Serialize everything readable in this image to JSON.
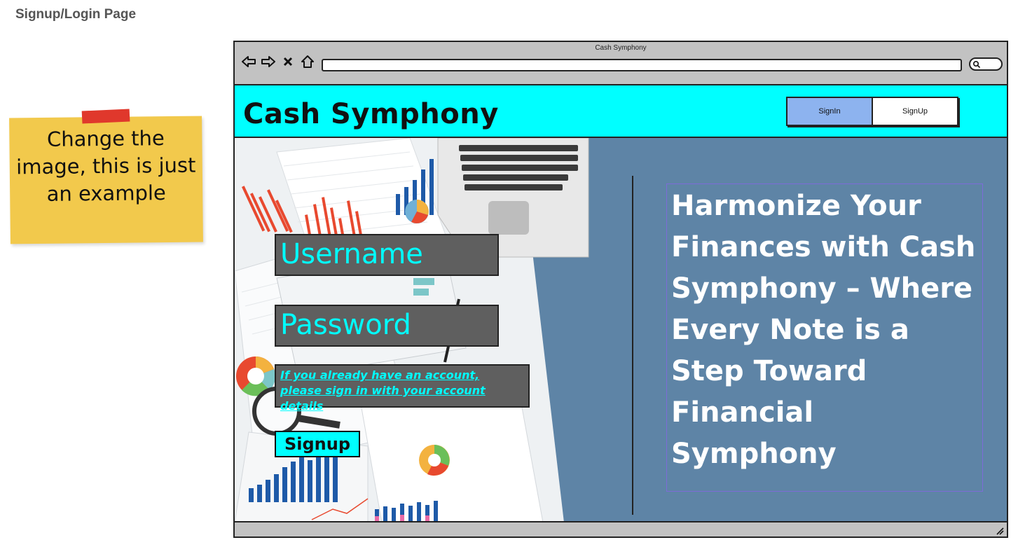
{
  "page_label": "Signup/Login Page",
  "sticky_note": {
    "text": "Change the image, this is just an example",
    "colors": {
      "note": "#f2c94c",
      "tape": "#e0382c"
    }
  },
  "browser": {
    "title": "Cash Symphony",
    "nav_icons": [
      "back-arrow-icon",
      "forward-arrow-icon",
      "close-icon",
      "home-icon"
    ],
    "url": "",
    "search_icon": "search-icon"
  },
  "header": {
    "brand": "Cash Symphony",
    "background": "#00ffff",
    "tabs": [
      {
        "label": "SignIn",
        "active": true
      },
      {
        "label": "SignUp",
        "active": false
      }
    ]
  },
  "form": {
    "username_placeholder": "Username",
    "password_placeholder": "Password",
    "signin_hint": "If you already have an account, please sign in with your account details",
    "signup_button": "Signup"
  },
  "tagline": "Harmonize Your Finances with Cash Symphony – Where Every Note is a Step Toward Financial Symphony",
  "colors": {
    "content_bg": "#5e84a6",
    "field_bg": "#5f5f5f",
    "field_text": "#00ffff",
    "active_tab": "#8db3ef"
  }
}
